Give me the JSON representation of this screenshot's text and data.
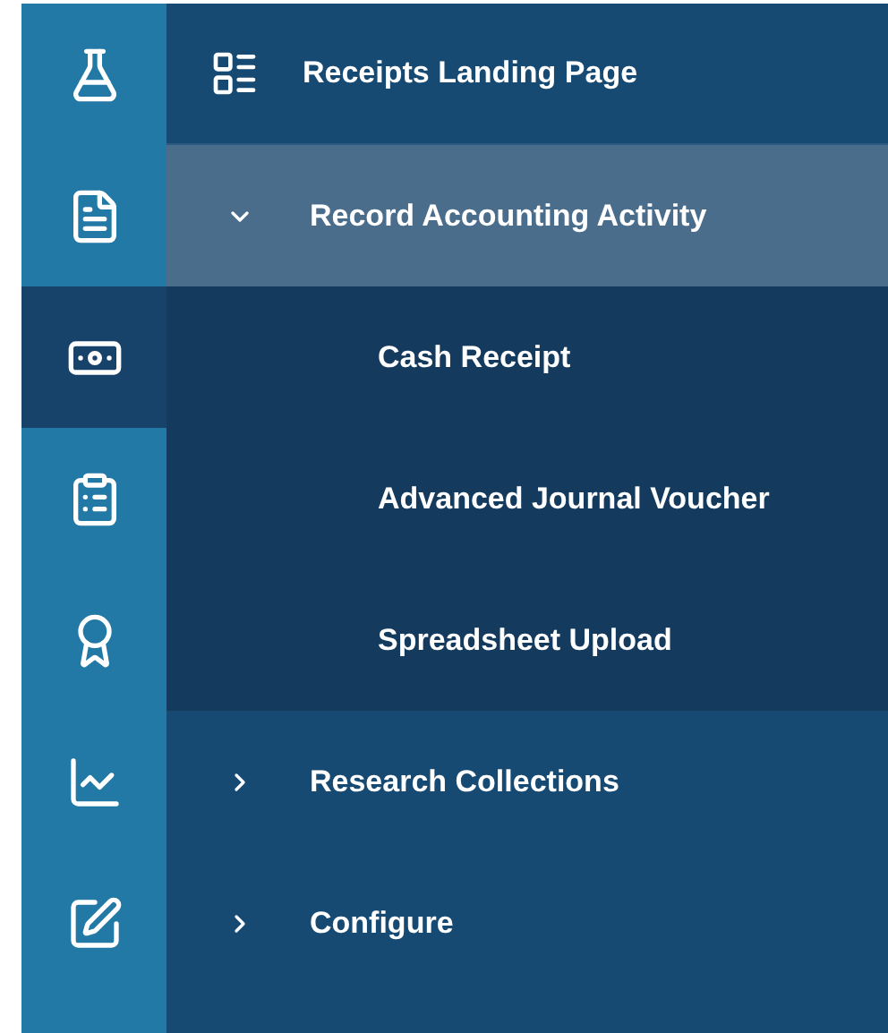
{
  "rail": [
    {
      "selected": false
    },
    {
      "selected": false
    },
    {
      "selected": true
    },
    {
      "selected": false
    },
    {
      "selected": false
    },
    {
      "selected": false
    },
    {
      "selected": false
    }
  ],
  "menu": [
    {
      "kind": "link",
      "label": "Receipts Landing Page"
    },
    {
      "kind": "group",
      "label": "Record Accounting Activity",
      "expanded": true,
      "children": [
        {
          "label": "Cash Receipt"
        },
        {
          "label": "Advanced Journal Voucher"
        },
        {
          "label": "Spreadsheet Upload"
        }
      ]
    },
    {
      "kind": "group",
      "label": "Research Collections",
      "expanded": false
    },
    {
      "kind": "group",
      "label": "Configure",
      "expanded": false
    }
  ]
}
